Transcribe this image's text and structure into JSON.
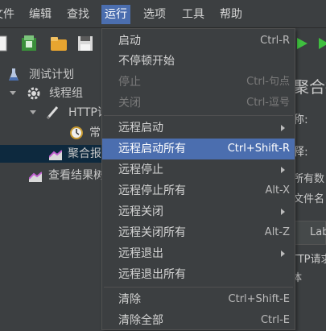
{
  "menubar": {
    "items": [
      {
        "label": "文件"
      },
      {
        "label": "编辑"
      },
      {
        "label": "查找"
      },
      {
        "label": "运行"
      },
      {
        "label": "选项"
      },
      {
        "label": "工具"
      },
      {
        "label": "帮助"
      }
    ]
  },
  "tree": {
    "test_plan": "测试计划",
    "thread_group": "线程组",
    "http_request": "HTTP请求",
    "constant_timer": "常",
    "aggregate_report": "聚合报告",
    "view_results": "查看结果树"
  },
  "right_panel": {
    "title": "聚合报",
    "name_label": "称:",
    "comment_label": "释:",
    "all_data": "所有数",
    "file_name": "文件名",
    "table_header": "Lab",
    "row_http": "TTP请求",
    "row_total": "体"
  },
  "run_menu": {
    "items": [
      {
        "label": "启动",
        "accel": "Ctrl-R"
      },
      {
        "label": "不停顿开始",
        "accel": ""
      },
      {
        "label": "停止",
        "accel": "Ctrl-句点"
      },
      {
        "label": "关闭",
        "accel": "Ctrl-逗号"
      },
      {
        "label": "远程启动",
        "accel": ""
      },
      {
        "label": "远程启动所有",
        "accel": "Ctrl+Shift-R"
      },
      {
        "label": "远程停止",
        "accel": ""
      },
      {
        "label": "远程停止所有",
        "accel": "Alt-X"
      },
      {
        "label": "远程关闭",
        "accel": ""
      },
      {
        "label": "远程关闭所有",
        "accel": "Alt-Z"
      },
      {
        "label": "远程退出",
        "accel": ""
      },
      {
        "label": "远程退出所有",
        "accel": ""
      },
      {
        "label": "清除",
        "accel": "Ctrl+Shift-E"
      },
      {
        "label": "清除全部",
        "accel": "Ctrl-E"
      }
    ]
  },
  "colors": {
    "background": "#3c3f41",
    "highlight": "#4b6eaf",
    "selected_row": "#0d293e",
    "run_icon": "#3fbf3f"
  }
}
